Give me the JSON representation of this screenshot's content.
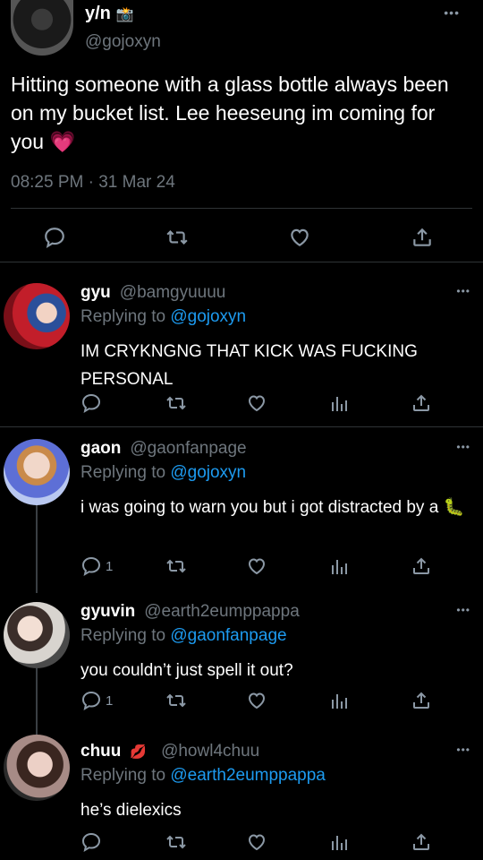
{
  "main_tweet": {
    "display_name": "y/n",
    "name_icon": "camera-emoji",
    "handle": "@gojoxyn",
    "text": "Hitting someone with a glass bottle always been on my bucket list. Lee heeseung im coming for you",
    "text_emoji": "💗",
    "timestamp": "08:25 PM · 31 Mar 24",
    "more": "•••"
  },
  "replies": [
    {
      "display_name": "gyu",
      "handle": "@bamgyuuuu",
      "replying_prefix": "Replying to",
      "replying_to": "@gojoxyn",
      "text": "IM CRYKNGNG THAT KICK WAS FUCKING PERSONAL",
      "reply_count": "",
      "more": "•••"
    },
    {
      "display_name": "gaon",
      "handle": "@gaonfanpage",
      "replying_prefix": "Replying to",
      "replying_to": "@gojoxyn",
      "text": "i was going to warn you but i got distracted by a",
      "text_emoji": "🐛",
      "reply_count": "1",
      "more": "•••"
    },
    {
      "display_name": "gyuvin",
      "handle": "@earth2eumppappa",
      "replying_prefix": "Replying to",
      "replying_to": "@gaonfanpage",
      "text": "you couldn’t just spell it out?",
      "reply_count": "1",
      "more": "•••"
    },
    {
      "display_name": "chuu",
      "name_emoji": "💋",
      "handle": "@howl4chuu",
      "replying_prefix": "Replying to",
      "replying_to": "@earth2eumppappa",
      "text": "he’s dielexics",
      "reply_count": "",
      "more": "•••"
    }
  ],
  "icons": [
    "reply-icon",
    "retweet-icon",
    "like-icon",
    "analytics-icon",
    "share-icon"
  ],
  "colors": {
    "background": "#000000",
    "text": "#e7e9ea",
    "muted": "#6e767d",
    "link": "#1d9bf0",
    "divider": "#2f3336"
  }
}
